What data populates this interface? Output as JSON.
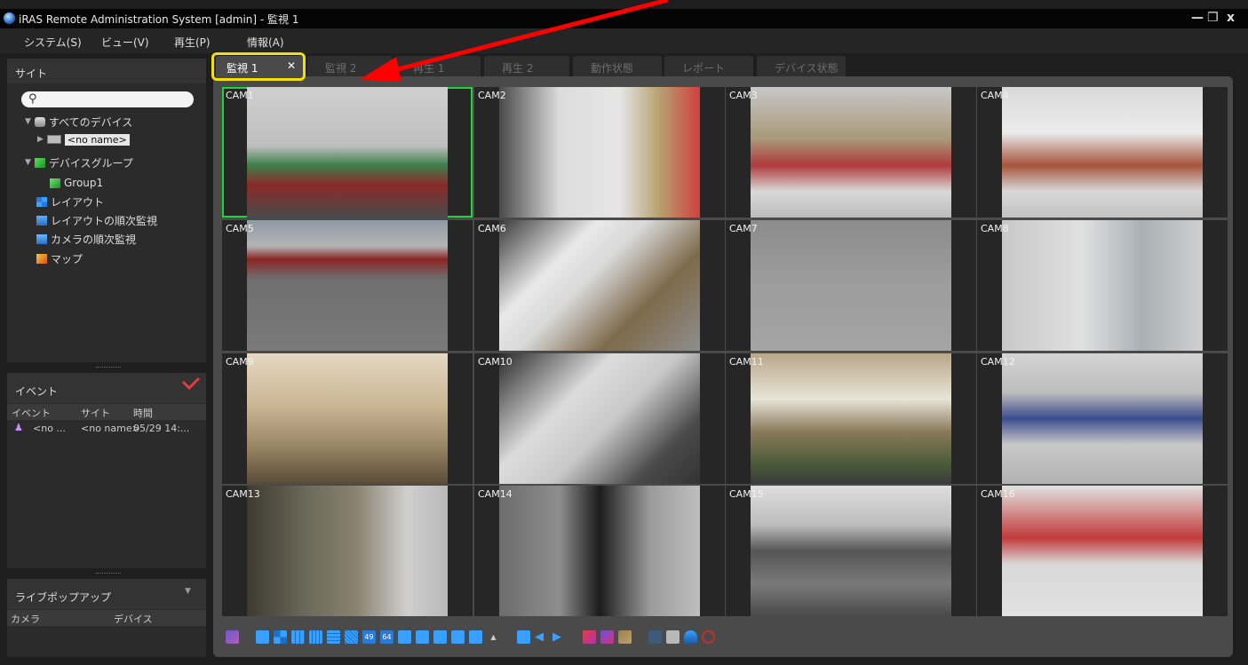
{
  "window": {
    "title": "iRAS Remote Administration System [admin] - 監視 1",
    "minimize_glyph": "—",
    "restore_glyph": "❐",
    "close_glyph": "x"
  },
  "menu": [
    {
      "label": "システム(S)"
    },
    {
      "label": "ビュー(V)"
    },
    {
      "label": "再生(P)"
    },
    {
      "label": "情報(A)"
    }
  ],
  "site_panel": {
    "title": "サイト",
    "search_icon": "search-icon",
    "tree": [
      {
        "label": "すべてのデバイス",
        "icon": "devices-icon"
      },
      {
        "label": "<no name>",
        "icon": "dvr-icon"
      },
      {
        "label": "デバイスグループ",
        "icon": "device-group-icon"
      },
      {
        "label": "Group1",
        "icon": "group-icon"
      },
      {
        "label": "レイアウト",
        "icon": "layout-icon"
      },
      {
        "label": "レイアウトの順次監視",
        "icon": "layout-sequence-icon"
      },
      {
        "label": "カメラの順次監視",
        "icon": "camera-sequence-icon"
      },
      {
        "label": "マップ",
        "icon": "map-icon"
      }
    ]
  },
  "event_panel": {
    "title": "イベント",
    "columns": [
      "イベント",
      "サイト",
      "時間"
    ],
    "rows": [
      {
        "event": "<no ...",
        "site": "<no name>",
        "time": "05/29 14:..."
      }
    ]
  },
  "popup_panel": {
    "title": "ライブポップアップ",
    "columns": [
      "カメラ",
      "デバイス"
    ]
  },
  "tabs": [
    {
      "label": "監視 1",
      "active": true,
      "close": "✕"
    },
    {
      "label": "監視 2"
    },
    {
      "label": "再生 1"
    },
    {
      "label": "再生 2"
    },
    {
      "label": "動作状態"
    },
    {
      "label": "レポート"
    },
    {
      "label": "デバイス状態"
    }
  ],
  "cameras": [
    {
      "label": "CAM1"
    },
    {
      "label": "CAM2"
    },
    {
      "label": "CAM3"
    },
    {
      "label": "CAM4"
    },
    {
      "label": "CAM5"
    },
    {
      "label": "CAM6"
    },
    {
      "label": "CAM7"
    },
    {
      "label": "CAM8"
    },
    {
      "label": "CAM9"
    },
    {
      "label": "CAM10"
    },
    {
      "label": "CAM11"
    },
    {
      "label": "CAM12"
    },
    {
      "label": "CAM13"
    },
    {
      "label": "CAM14"
    },
    {
      "label": "CAM15"
    },
    {
      "label": "CAM16"
    }
  ],
  "toolbar": {
    "layout_49_label": "49",
    "layout_64_label": "64"
  },
  "colors": {
    "selected_outline": "#23d23d",
    "tab_highlight": "#f5e000",
    "annotation_arrow": "#ff0000"
  }
}
